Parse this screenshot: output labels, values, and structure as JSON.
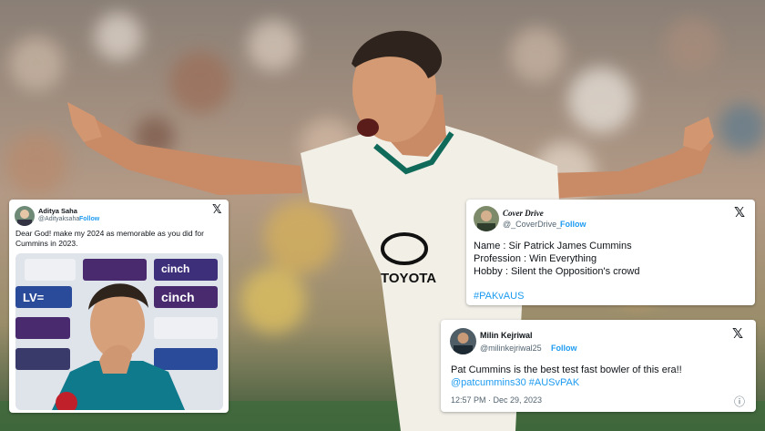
{
  "tweets": [
    {
      "name": "Aditya Saha",
      "handle": "@Adityaksaha",
      "follow": "Follow",
      "text": "Dear God! make my 2024 as memorable as you did for Cummins in 2023."
    },
    {
      "name": "Cover Drive",
      "handle": "@_CoverDrive_",
      "follow": "Follow",
      "lines": [
        "Name : Sir Patrick James Cummins",
        "Profession : Win Everything",
        "Hobby : Silent the Opposition's crowd"
      ],
      "hashtag": "#PAKvAUS"
    },
    {
      "name": "Milin Kejriwal",
      "handle": "@milinkejriwal25",
      "follow": "Follow",
      "text": "Pat Cummins is the best test fast bowler of this era!!",
      "tags": "@patcummins30 #AUSvPAK",
      "time": "12:57 PM · Dec 29, 2023"
    }
  ],
  "photo": {
    "logo_text": "TOYOTA",
    "sponsor_banners": [
      "cinch",
      "LV=",
      "cinch"
    ]
  },
  "x_glyph": "𝕏",
  "info_glyph": "ⓘ",
  "colors": {
    "link": "#1d9bf0",
    "handle": "#536471",
    "kit": "#f1efe6",
    "kit_trim": "#0f6a5a"
  }
}
